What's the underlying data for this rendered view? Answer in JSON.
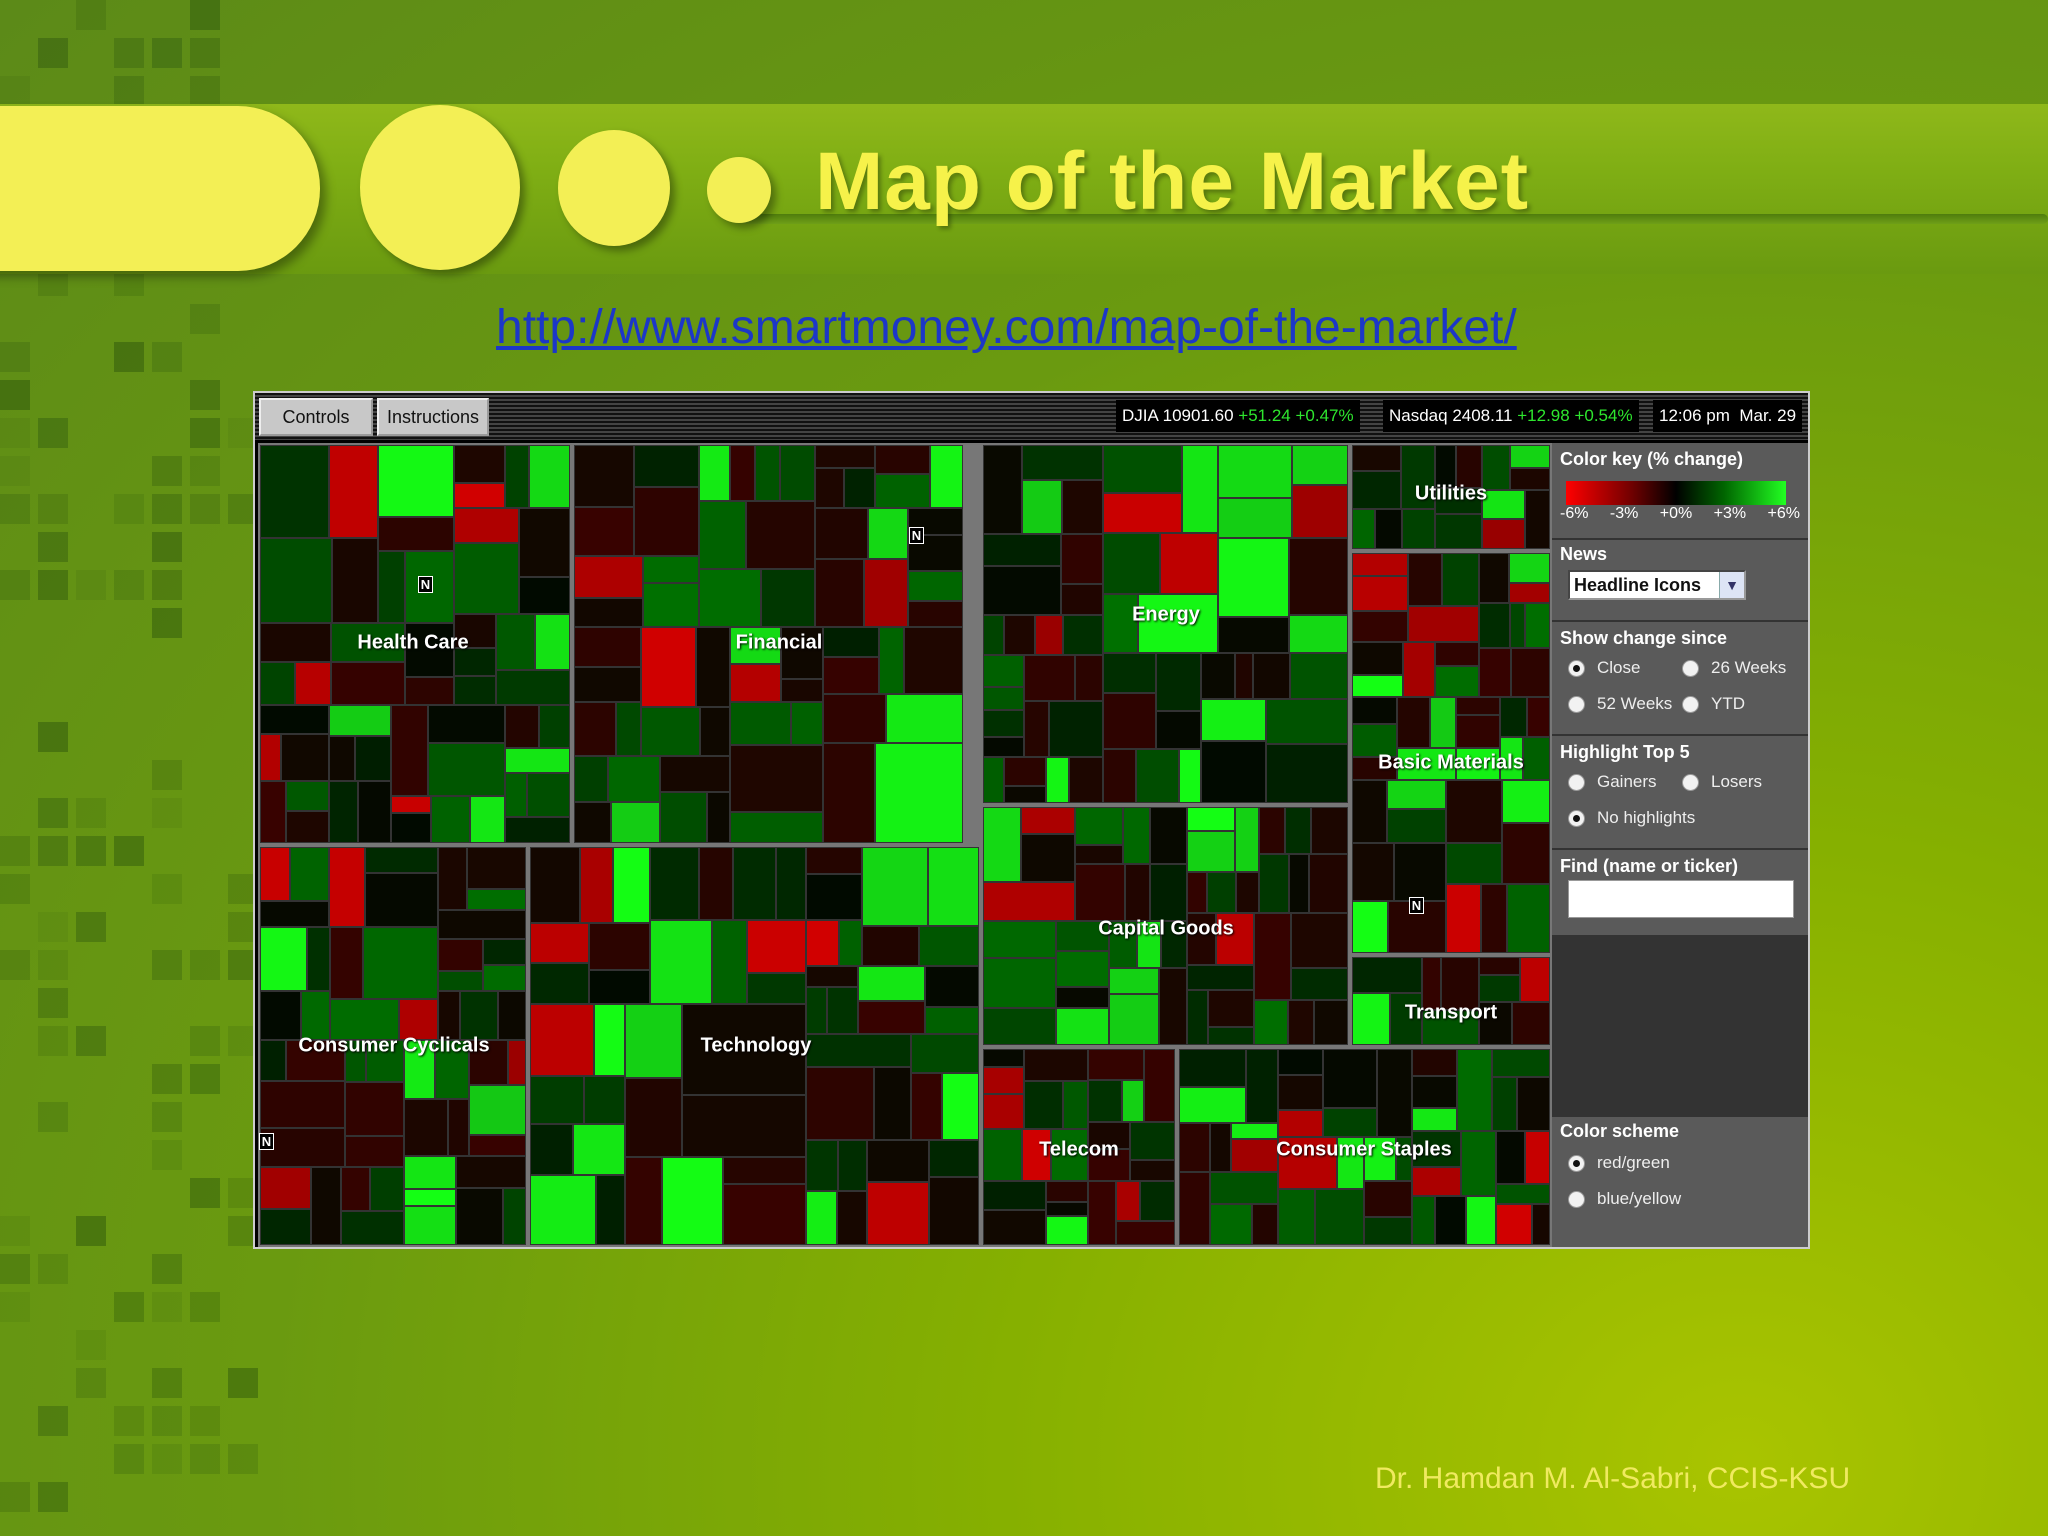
{
  "slide": {
    "title": "Map of the Market",
    "url": "http://www.smartmoney.com/map-of-the-market/",
    "footer": "Dr. Hamdan M. Al-Sabri, CCIS-KSU"
  },
  "app": {
    "buttons": {
      "controls": "Controls",
      "instructions": "Instructions"
    },
    "ticker": {
      "djia_label": "DJIA 10901.60",
      "djia_change": "+51.24 +0.47%",
      "nasdaq_label": "Nasdaq 2408.11",
      "nasdaq_change": "+12.98 +0.54%",
      "time": "12:06 pm",
      "date": "Mar. 29"
    },
    "sectors": {
      "health_care": "Health Care",
      "financial": "Financial",
      "energy": "Energy",
      "utilities": "Utilities",
      "basic_materials": "Basic Materials",
      "capital_goods": "Capital Goods",
      "transport": "Transport",
      "consumer_cyclicals": "Consumer Cyclicals",
      "technology": "Technology",
      "telecom": "Telecom",
      "consumer_staples": "Consumer Staples"
    },
    "news_icon": "N",
    "panel": {
      "color_key": {
        "header": "Color key (% change)",
        "ticks": [
          "-6%",
          "-3%",
          "+0%",
          "+3%",
          "+6%"
        ]
      },
      "news": {
        "header": "News",
        "selected": "Headline Icons"
      },
      "change_since": {
        "header": "Show change since",
        "close": "Close",
        "w26": "26 Weeks",
        "w52": "52 Weeks",
        "ytd": "YTD",
        "selected": "Close"
      },
      "highlight": {
        "header": "Highlight Top 5",
        "gainers": "Gainers",
        "losers": "Losers",
        "none": "No highlights",
        "selected": "No highlights"
      },
      "find": {
        "header": "Find (name or ticker)",
        "value": ""
      },
      "color_scheme": {
        "header": "Color scheme",
        "red_green": "red/green",
        "blue_yellow": "blue/yellow",
        "selected": "red/green"
      }
    },
    "colors": {
      "gain_strong": "#22ff22",
      "gain": "#0a7a0a",
      "neutral": "#000000",
      "loss": "#5a0000",
      "loss_strong": "#cc0000"
    }
  }
}
